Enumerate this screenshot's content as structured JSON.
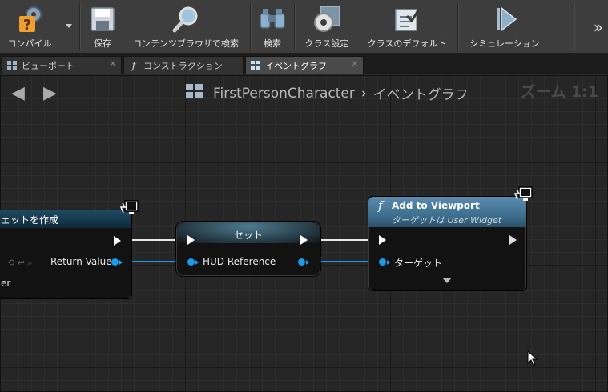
{
  "toolbar": {
    "compile": "コンパイル",
    "save": "保存",
    "content_browser": "コンテンツブラウザで検索",
    "search": "検索",
    "class_settings": "クラス設定",
    "class_defaults": "クラスのデフォルト",
    "simulation": "シミュレーション",
    "overflow": "»"
  },
  "tabs": [
    {
      "label": "ビューポート",
      "icon": "viewport-icon"
    },
    {
      "label": "コンストラクション",
      "icon": "function-icon"
    },
    {
      "label": "イベントグラフ",
      "icon": "graph-icon"
    }
  ],
  "breadcrumb": {
    "class_name": "FirstPersonCharacter",
    "separator": "›",
    "graph_name": "イベントグラフ"
  },
  "zoom": "ズーム 1:1",
  "nodes": {
    "create_widget": {
      "title": "ェットを作成",
      "return_value": "Return Value",
      "partial_pin": "er"
    },
    "set": {
      "title": "セット",
      "hud_reference": "HUD Reference"
    },
    "add_to_viewport": {
      "title": "Add to Viewport",
      "subtitle": "ターゲットは User Widget",
      "target": "ターゲット"
    }
  },
  "colors": {
    "object_pin": "#1e9be8",
    "function_header": "#3f6f8f",
    "set_header": "#2f4f5f"
  }
}
